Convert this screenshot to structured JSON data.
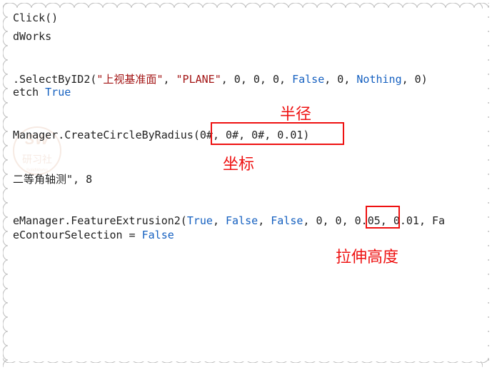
{
  "code": {
    "l1": "Click()",
    "l2": "dWorks",
    "l3_pre": ".SelectByID2(",
    "l3_s1": "\"上视基准面\"",
    "l3_c1": ", ",
    "l3_s2": "\"PLANE\"",
    "l3_mid": ", 0, 0, 0, ",
    "l3_kw1": "False",
    "l3_mid2": ", 0, ",
    "l3_kw2": "Nothing",
    "l3_end": ", 0)",
    "l4_pre": "etch ",
    "l4_kw": "True",
    "l5": "Manager.CreateCircleByRadius(0#, 0#, 0#, 0.01)",
    "l6": "二等角轴测\", 8",
    "l7_pre": "eManager.FeatureExtrusion2(",
    "l7_kw1": "True",
    "l7_c": ", ",
    "l7_kw2": "False",
    "l7_kw3": "False",
    "l7_mid": ", 0, 0, ",
    "l7_v1": "0.05,",
    "l7_v2": " 0.01, ",
    "l7_end": "Fa",
    "l8_pre": "eContourSelection = ",
    "l8_kw": "False"
  },
  "annotations": {
    "radius": "半径",
    "coord": "坐标",
    "height": "拉伸高度"
  },
  "watermark": {
    "top": "SW",
    "mid": "研习社"
  }
}
